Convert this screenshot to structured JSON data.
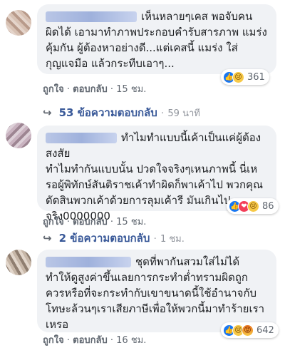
{
  "comments": [
    {
      "text_line1": "เห็นหลายๆเคส พอจับคน",
      "text_rest": "ผิดได้ เอามาทำภาพประกอบคำรับสารภาพ แมร่งคุ้มกัน ผู้ต้องหาอย่างดี...แต่เคสนี้ แมร่ง ใส่กุญแจมือ แล้วกระทืบเอาๆ...",
      "like": "ถูกใจ",
      "reply": "ตอบกลับ",
      "time": "15 ชม.",
      "reactions": [
        "like-icon",
        "sad-icon"
      ],
      "reaction_count": "361",
      "replies_label": "53 ข้อความตอบกลับ",
      "replies_time": "59 นาที"
    },
    {
      "text_line1": "ทำไมทำแบบนี้เค้าเป็นแค่ผู้ต้องสงสัย",
      "text_rest": "ทำไมทำกันแบบนั้น ปวดใจจริงๆเหนภาพนี้ นี่เหรอผู้พิทักษ์สันติราชเค้าทำผิดก็พาเค้าไป พวกคุณดัดสินพวกเค้าด้วยการลุมเค้ารี มันเกินไปจริง0000000",
      "like": "ถูกใจ",
      "reply": "ตอบกลับ",
      "time": "15 ชม.",
      "reactions": [
        "like-icon",
        "love-icon",
        "sad-icon"
      ],
      "reaction_count": "86",
      "replies_label": "2 ข้อความตอบกลับ",
      "replies_time": "1 ชม."
    },
    {
      "text_line1": "ชุดที่พากันสวมใส่ไม่ได้",
      "text_rest": "ทำให้ดูสูงค่าขึ้นเลยการกระทำต่ำทรามผิดถูก ควรหรือที่จะกระทำกับเขาขนาดนี้ใช้อำนาจกับโทษะล้วนๆเราเสียภาษีเพื่อให้พวกนี้มาทำร้ายเราเหรอ",
      "like": "ถูกใจ",
      "reply": "ตอบกลับ",
      "time": "16 ชม.",
      "reactions": [
        "like-icon",
        "sad-icon",
        "angry-icon"
      ],
      "reaction_count": "642"
    }
  ],
  "sep": "·",
  "colors": {
    "bubble": "#f0f2f5",
    "link": "#385898",
    "meta": "#606770",
    "like_blue": "#1877f2"
  }
}
